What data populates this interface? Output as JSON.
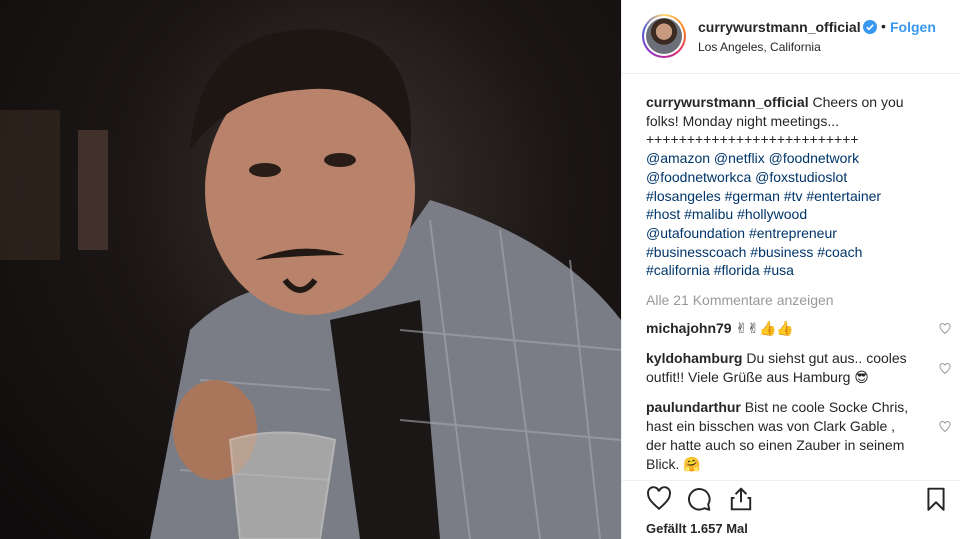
{
  "post": {
    "username": "currywurstmann_official",
    "follow_label": "Folgen",
    "separator": "•",
    "location": "Los Angeles, California"
  },
  "caption": {
    "username": "currywurstmann_official",
    "text": "Cheers on you folks! Monday night meetings...",
    "plus_line": "++++++++++++++++++++++++++",
    "mentions": [
      "@amazon",
      "@netflix",
      "@foodnetwork",
      "@foodnetworkca",
      "@foxstudioslot"
    ],
    "hashtags_1": [
      "#losangeles",
      "#german",
      "#tv",
      "#entertainer",
      "#host",
      "#malibu",
      "#hollywood"
    ],
    "mentions_2": [
      "@utafoundation"
    ],
    "hashtags_2": [
      "#entrepreneur",
      "#businesscoach",
      "#business",
      "#coach",
      "#california",
      "#florida",
      "#usa"
    ]
  },
  "view_all_comments": "Alle 21 Kommentare anzeigen",
  "comments": [
    {
      "username": "michajohn79",
      "text": "✌✌👍👍"
    },
    {
      "username": "kyldohamburg",
      "text": "Du siehst gut aus.. cooles outfit!! Viele Grüße aus Hamburg 😎"
    },
    {
      "username": "paulundarthur",
      "text": "Bist ne coole Socke Chris, hast ein bisschen was von Clark Gable , der hatte auch so einen Zauber in seinem Blick. 🤗"
    }
  ],
  "likes_text": "Gefällt 1.657 Mal",
  "icons": {
    "verified": "verified-badge-icon",
    "like": "heart-icon",
    "comment": "comment-bubble-icon",
    "share": "share-icon",
    "save": "bookmark-icon"
  },
  "colors": {
    "link_blue": "#3897f0",
    "hashtag": "#003569",
    "muted": "#999999",
    "text": "#262626"
  }
}
